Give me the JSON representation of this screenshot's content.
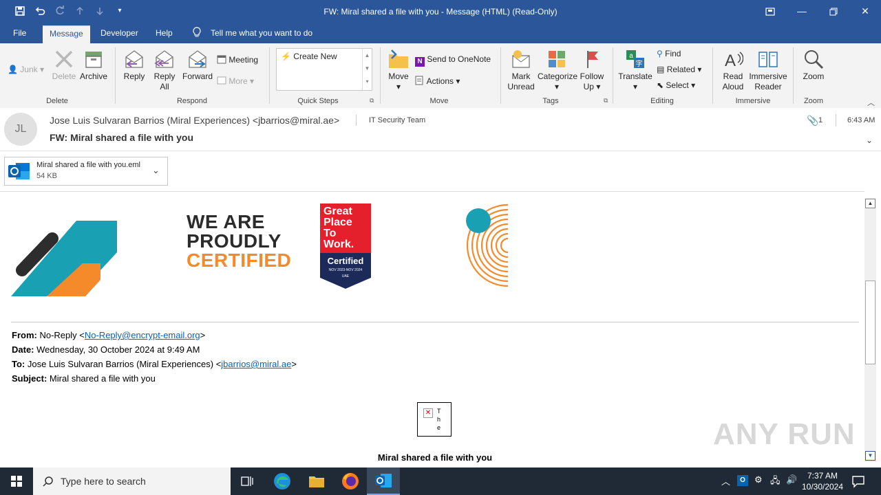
{
  "window": {
    "title": "FW: Miral shared a file with you  -  Message (HTML) (Read-Only)",
    "accent_color": "#2b579a"
  },
  "menu": {
    "file": "File",
    "message": "Message",
    "developer": "Developer",
    "help": "Help",
    "tell_me": "Tell me what you want to do"
  },
  "ribbon": {
    "junk": "Junk",
    "delete": "Delete",
    "archive": "Archive",
    "group_delete": "Delete",
    "reply": "Reply",
    "reply_all_1": "Reply",
    "reply_all_2": "All",
    "forward": "Forward",
    "meeting": "Meeting",
    "more": "More",
    "group_respond": "Respond",
    "create_new": "Create New",
    "group_quick_steps": "Quick Steps",
    "move": "Move",
    "send_onenote": "Send to OneNote",
    "actions": "Actions",
    "group_move": "Move",
    "mark_unread_1": "Mark",
    "mark_unread_2": "Unread",
    "categorize": "Categorize",
    "follow_up_1": "Follow",
    "follow_up_2": "Up",
    "group_tags": "Tags",
    "translate": "Translate",
    "find": "Find",
    "related": "Related",
    "select": "Select",
    "group_editing": "Editing",
    "read_aloud_1": "Read",
    "read_aloud_2": "Aloud",
    "immersive_1": "Immersive",
    "immersive_2": "Reader",
    "group_immersive": "Immersive",
    "zoom": "Zoom",
    "group_zoom": "Zoom"
  },
  "header": {
    "avatar_initials": "JL",
    "sender": "Jose Luis Sulvaran Barrios (Miral Experiences) <jbarrios@miral.ae>",
    "to": "IT Security Team",
    "attachment_count": "1",
    "time": "6:43 AM",
    "subject": "FW: Miral shared a file with you"
  },
  "attachment": {
    "name": "Miral shared a file with you.eml",
    "size": "54 KB"
  },
  "body": {
    "banner_line1": "WE ARE",
    "banner_line2": "PROUDLY",
    "banner_line3": "CERTIFIED",
    "gptw_1": "Great",
    "gptw_2": "Place",
    "gptw_3": "To",
    "gptw_4": "Work.",
    "gptw_cert": "Certified",
    "gptw_dates": "NOV 2023-NOV 2024",
    "gptw_region": "UAE",
    "from_label": "From:",
    "from_name": "No-Reply <",
    "from_email": "No-Reply@encrypt-email.org",
    "from_close": ">",
    "date_label": "Date:",
    "date_value": "Wednesday, 30 October 2024 at 9:49 AM",
    "to_label": "To:",
    "to_name": "Jose Luis Sulvaran Barrios (Miral Experiences) <",
    "to_email": "jbarrios@miral.ae",
    "to_close": ">",
    "subject_label": "Subject:",
    "subject_value": "Miral shared a file with you",
    "broken_img_text": "The",
    "heading": "Miral shared a file with you",
    "watermark": "ANY RUN"
  },
  "taskbar": {
    "search_placeholder": "Type here to search",
    "clock_time": "7:37 AM",
    "clock_date": "10/30/2024"
  }
}
